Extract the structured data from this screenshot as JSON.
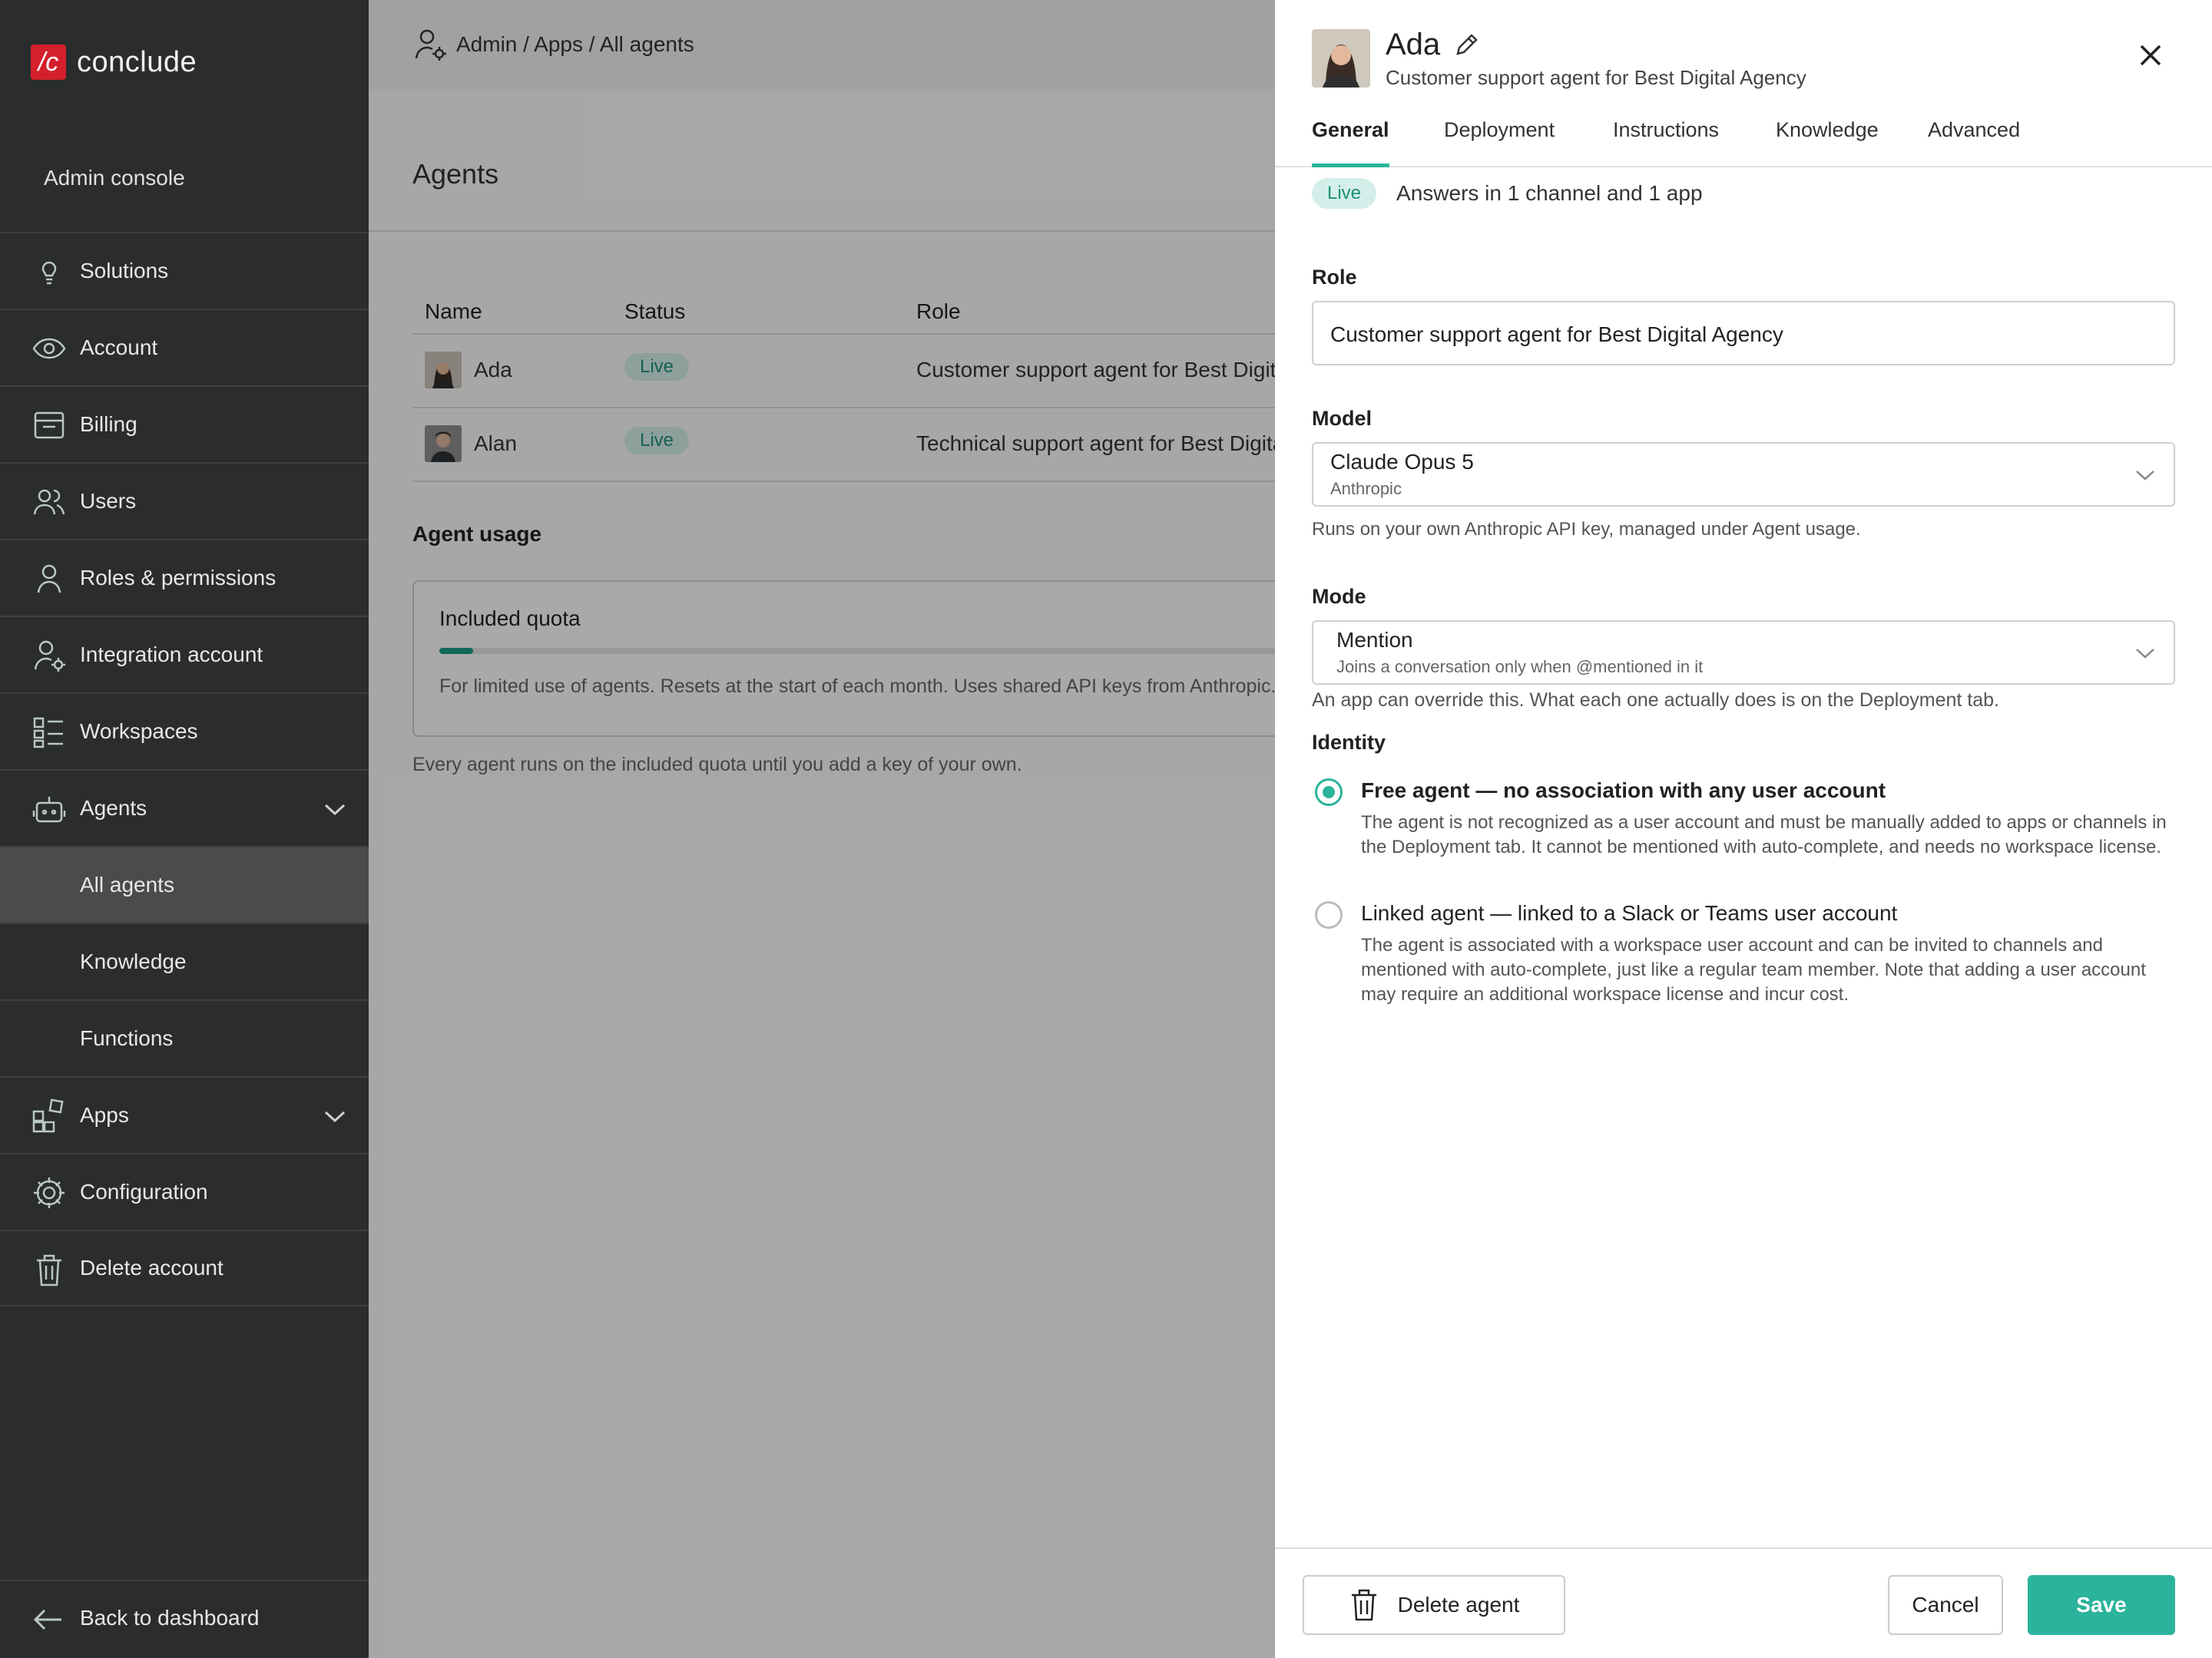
{
  "sidebar": {
    "logo_mark": "/c",
    "logo_text": "conclude",
    "admin_label": "Admin console",
    "items": [
      {
        "label": "Solutions"
      },
      {
        "label": "Account"
      },
      {
        "label": "Billing"
      },
      {
        "label": "Users"
      },
      {
        "label": "Roles & permissions"
      },
      {
        "label": "Integration account"
      },
      {
        "label": "Workspaces"
      },
      {
        "label": "Agents"
      },
      {
        "label": "All agents"
      },
      {
        "label": "Knowledge"
      },
      {
        "label": "Functions"
      },
      {
        "label": "Apps"
      },
      {
        "label": "Configuration"
      },
      {
        "label": "Delete account"
      }
    ],
    "back_label": "Back to dashboard"
  },
  "main": {
    "breadcrumb": "Admin / Apps / All agents",
    "title": "Agents",
    "table": {
      "headers": {
        "name": "Name",
        "status": "Status",
        "role": "Role"
      },
      "rows": [
        {
          "name": "Ada",
          "status": "Live",
          "role": "Customer support agent for Best Digital Agency"
        },
        {
          "name": "Alan",
          "status": "Live",
          "role": "Technical support agent for Best Digital Agency"
        }
      ]
    },
    "usage_title": "Agent usage",
    "quota": {
      "label": "Included quota",
      "progress": 0.04,
      "desc": "For limited use of agents. Resets at the start of each month. Uses shared API keys from Anthropic."
    },
    "quota_note": "Every agent runs on the included quota until you add a key of your own."
  },
  "drawer": {
    "name": "Ada",
    "subtitle": "Customer support agent for Best Digital Agency",
    "tabs": [
      "General",
      "Deployment",
      "Instructions",
      "Knowledge",
      "Advanced"
    ],
    "status_badge": "Live",
    "status_text": "Answers in 1 channel and 1 app",
    "role_label": "Role",
    "role_value": "Customer support agent for Best Digital Agency",
    "model_label": "Model",
    "model_value": "Claude Opus 5",
    "model_provider": "Anthropic",
    "model_hint": "Runs on your own Anthropic API key, managed under Agent usage.",
    "mode_label": "Mode",
    "mode_value": "Mention",
    "mode_desc": "Joins a conversation only when @mentioned in it",
    "mode_hint": "An app can override this. What each one actually does is on the Deployment tab.",
    "identity_label": "Identity",
    "identity_options": [
      {
        "title": "Free agent — no association with any user account",
        "desc": "The agent is not recognized as a user account and must be manually added to apps or channels in the Deployment tab. It cannot be mentioned with auto-complete, and needs no workspace license.",
        "selected": true
      },
      {
        "title": "Linked agent — linked to a Slack or Teams user account",
        "desc": "The agent is associated with a workspace user account and can be invited to channels and mentioned with auto-complete, just like a regular team member. Note that adding a user account may require an additional workspace license and incur cost.",
        "selected": false
      }
    ],
    "footer": {
      "delete": "Delete agent",
      "cancel": "Cancel",
      "save": "Save"
    }
  },
  "colors": {
    "accent": "#2bb39b",
    "sidebar_bg": "#2b2c2c",
    "brand_red": "#d4202c",
    "badge_bg": "#d4efe9"
  },
  "icons": [
    "lightbulb-icon",
    "eye-icon",
    "billing-icon",
    "users-icon",
    "person-icon",
    "person-gear-icon",
    "workspaces-icon",
    "robot-icon",
    "apps-icon",
    "gear-icon",
    "trash-icon",
    "arrow-left-icon",
    "pencil-icon",
    "close-icon",
    "chevron-down-icon"
  ]
}
